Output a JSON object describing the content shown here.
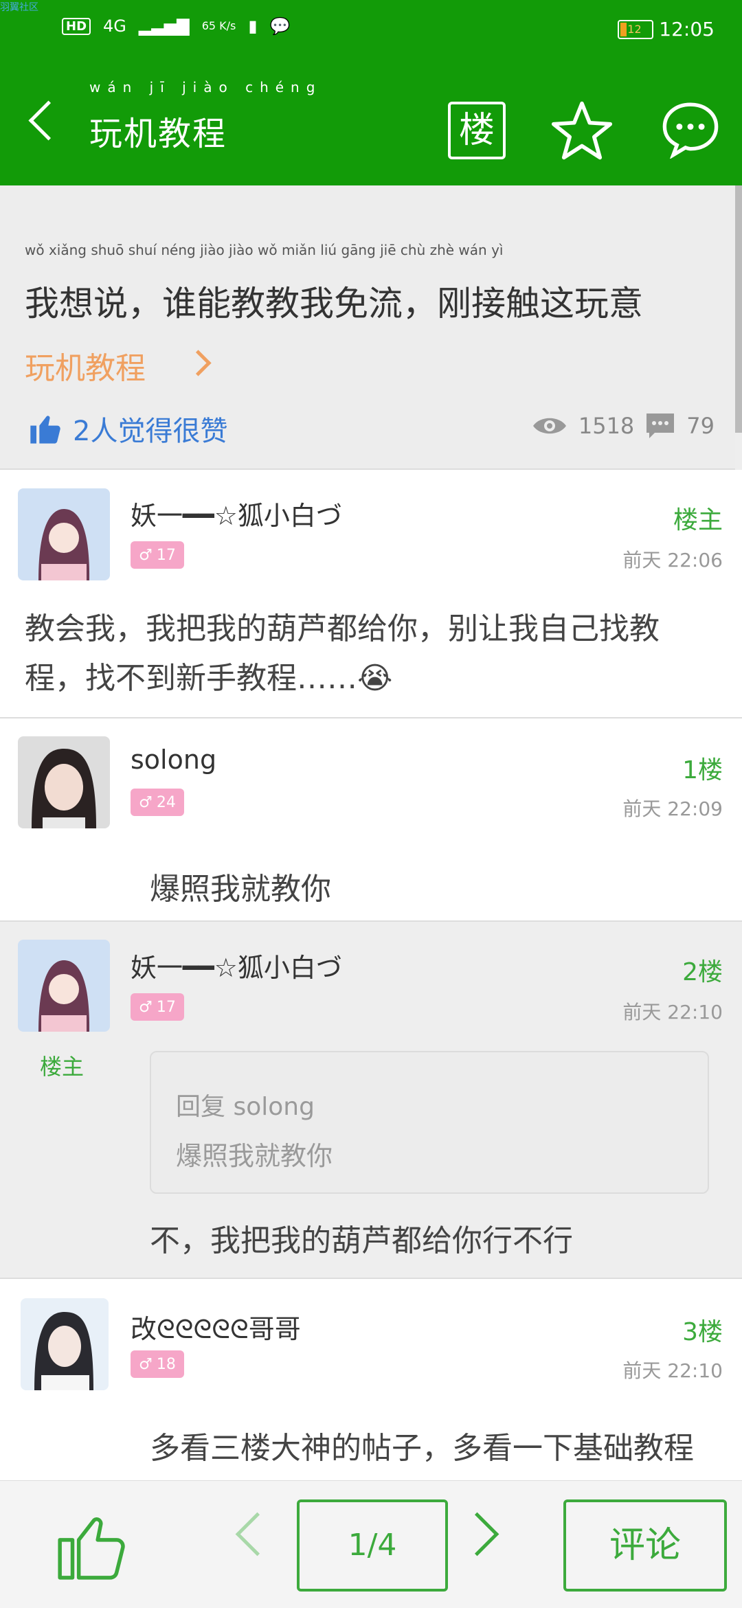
{
  "colors": {
    "primary": "#129b08",
    "accent_green": "#3caa3c",
    "orange": "#f0a060",
    "blue": "#3a7bd5"
  },
  "statusbar": {
    "watermark": "羽翼社区",
    "hd": "HD",
    "network": "4G",
    "speed": "65 K/s",
    "battery": "12",
    "time": "12:05"
  },
  "header": {
    "title": "玩机教程",
    "title_pinyin": "wán jī jiào chéng",
    "floor_button": "楼"
  },
  "post": {
    "title": "我想说，谁能教教我免流，刚接触这玩意",
    "title_pinyin": "wǒ xiǎng shuō   shuí néng jiào jiào wǒ miǎn liú   gāng jiē chù zhè wán yì",
    "category": "玩机教程",
    "likes_text": "2人觉得很赞",
    "views": "1518",
    "comments": "79"
  },
  "replies": [
    {
      "user": "妖一━━☆狐小白づ",
      "level": "17",
      "floor": "楼主",
      "time": "前天 22:06",
      "content": "教会我，我把我的葫芦都给你，别让我自己找教程，找不到新手教程……😭"
    },
    {
      "user": "solong",
      "level": "24",
      "floor": "1楼",
      "time": "前天 22:09",
      "content": "爆照我就教你"
    },
    {
      "user": "妖一━━☆狐小白づ",
      "level": "17",
      "floor": "2楼",
      "time": "前天 22:10",
      "op_tag": "楼主",
      "quote_head": "回复 solong",
      "quote_body": "爆照我就教你",
      "content": "不，我把我的葫芦都给你行不行"
    },
    {
      "user": "改ᘓᘓᘓᘓᘓ哥哥",
      "level": "18",
      "floor": "3楼",
      "time": "前天 22:10",
      "content": "多看三楼大神的帖子，多看一下基础教程"
    }
  ],
  "bottom": {
    "page": "1/4",
    "comment": "评论"
  }
}
